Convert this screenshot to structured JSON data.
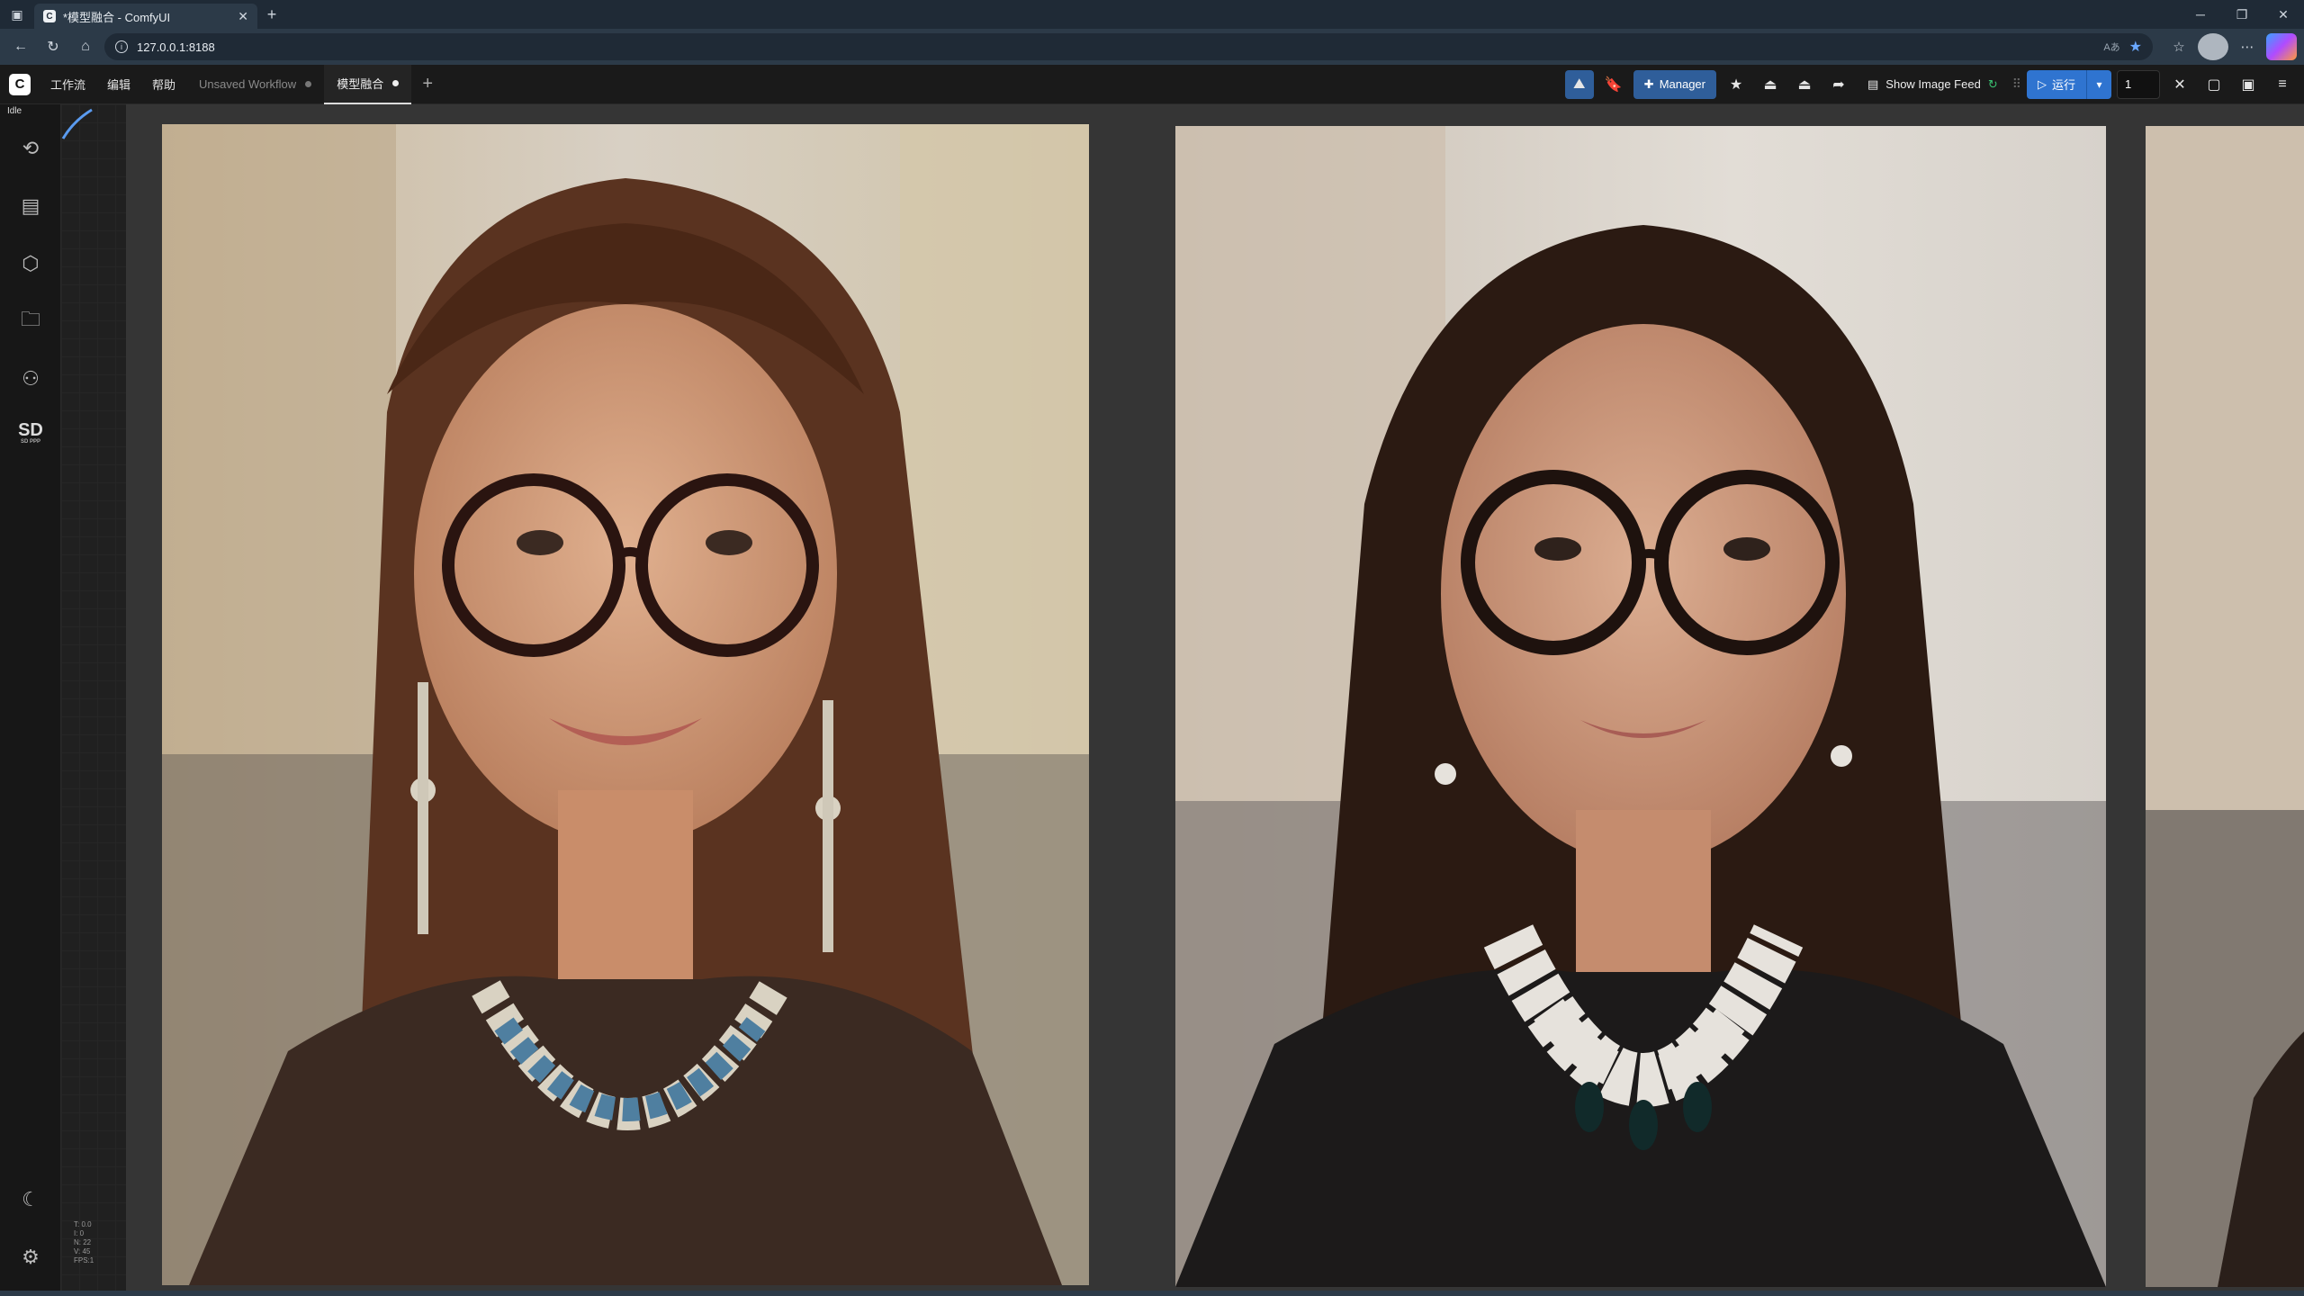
{
  "browser": {
    "tab_title": "*模型融合 - ComfyUI",
    "url": "127.0.0.1:8188",
    "favicon_letter": "C"
  },
  "menubar": {
    "items": [
      "工作流",
      "编辑",
      "帮助"
    ],
    "workflow_tabs": [
      {
        "label": "Unsaved Workflow",
        "active": false
      },
      {
        "label": "模型融合",
        "active": true
      }
    ],
    "manager_label": "Manager",
    "show_image_feed_label": "Show Image Feed",
    "run_label": "运行",
    "batch_count": "1"
  },
  "sidebar": {
    "status": "Idle",
    "icons": [
      "history-icon",
      "queue-icon",
      "model-library-icon",
      "workflows-folder-icon",
      "node-library-icon",
      "sd-ppp-icon"
    ],
    "sd_label": "SD",
    "sd_sub": "SD PPP"
  },
  "canvas": {
    "stats": [
      "T: 0.0",
      "I: 0",
      "N: 22",
      "V: 45",
      "FPS:1"
    ]
  },
  "colors": {
    "accent_blue": "#2f74d0",
    "manager_blue": "#2f5e9a",
    "canvas_bg": "#202020"
  }
}
